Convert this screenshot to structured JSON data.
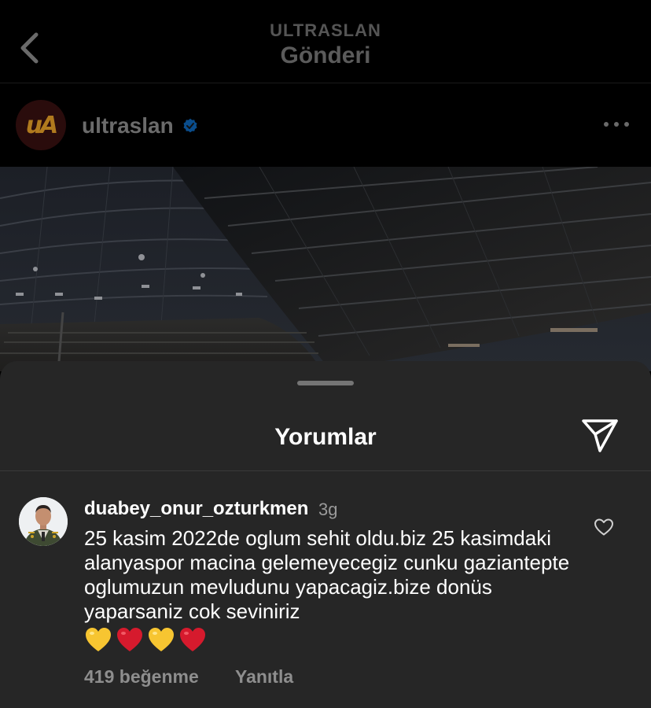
{
  "header": {
    "subtitle": "ULTRASLAN",
    "title": "Gönderi"
  },
  "post": {
    "username": "ultraslan",
    "verified": true,
    "avatar_text": "uA"
  },
  "comments_sheet": {
    "title": "Yorumlar",
    "comment": {
      "username": "duabey_onur_ozturkmen",
      "time": "3g",
      "text": "25 kasim 2022de oglum sehit oldu.biz 25 kasimdaki alanyaspor macina gelemeyecegiz cunku gaziantepte oglumuzun mevludunu yapacagiz.bize donüs yaparsaniz cok seviniriz",
      "emojis": [
        "yellow-heart",
        "red-heart",
        "yellow-heart",
        "red-heart"
      ],
      "likes_label": "419 beğenme",
      "reply_label": "Yanıtla"
    }
  },
  "colors": {
    "sheet_bg": "#262626",
    "verified_blue": "#0095f6",
    "muted_text": "#8e8e8e",
    "yellow_heart": "#f7c531",
    "red_heart": "#d61a2d"
  },
  "icons": {
    "back": "chevron-left-icon",
    "more": "more-horizontal-icon",
    "share": "send-icon",
    "like": "heart-outline-icon",
    "verified": "verified-badge-icon"
  }
}
